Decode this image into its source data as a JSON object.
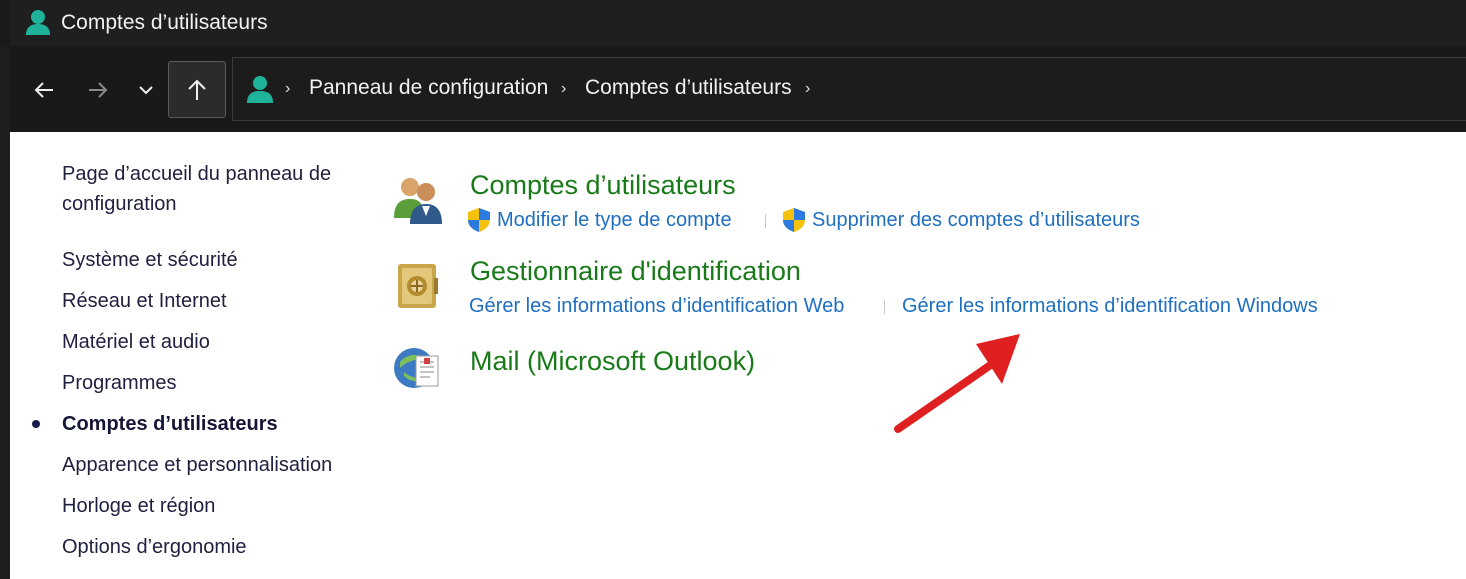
{
  "window": {
    "title": "Comptes d’utilisateurs"
  },
  "address_bar": {
    "crumbs": [
      "Panneau de configuration",
      "Comptes d’utilisateurs"
    ],
    "separator": "›"
  },
  "left_nav": {
    "home": "Page d’accueil du panneau de configuration",
    "items": [
      "Système et sécurité",
      "Réseau et Internet",
      "Matériel et audio",
      "Programmes",
      "Comptes d’utilisateurs",
      "Apparence et personnalisation",
      "Horloge et région",
      "Options d’ergonomie"
    ],
    "active_index": 4
  },
  "categories": [
    {
      "title": "Comptes d’utilisateurs",
      "icon": "users-icon",
      "tasks": [
        "Modifier le type de compte",
        "Supprimer des comptes d’utilisateurs"
      ]
    },
    {
      "title": "Gestionnaire d'identification",
      "icon": "credential-vault-icon",
      "tasks": [
        "Gérer les informations d’identification Web",
        "Gérer les informations d’identification Windows"
      ]
    },
    {
      "title": "Mail (Microsoft Outlook)",
      "icon": "mail-icon",
      "tasks": []
    }
  ],
  "colors": {
    "category_title": "#1a7a1a",
    "task_link": "#1f6fc0",
    "annotation_arrow": "#e02020",
    "titlebar_bg": "#1f1f1f",
    "content_bg": "#ffffff"
  }
}
